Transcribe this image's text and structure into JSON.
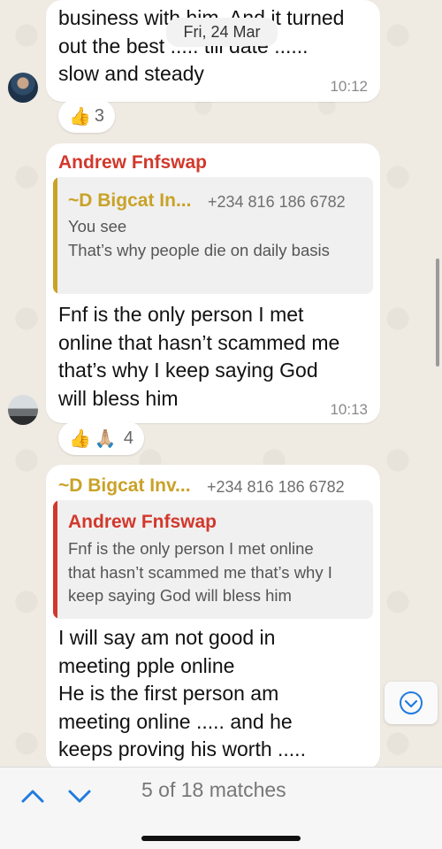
{
  "date_chip": "Fri, 24 Mar",
  "messages": [
    {
      "lines": [
        "business with him. And it turned",
        "out the best ..... till date ......",
        "slow and steady"
      ],
      "time": "10:12",
      "reaction": {
        "emojis": [
          "👍"
        ],
        "count": "3"
      }
    },
    {
      "sender": "Andrew Fnfswap",
      "quote": {
        "name": "~D Bigcat In...",
        "phone": "+234 816 186 6782",
        "lines": [
          "You see",
          "That’s why people die on daily basis"
        ]
      },
      "lines": [
        "Fnf is the only person I met",
        "online that hasn’t scammed me",
        "that’s why I keep saying God",
        "will bless him"
      ],
      "time": "10:13",
      "reaction": {
        "emojis": [
          "👍",
          "🙏🏼"
        ],
        "count": "4"
      }
    },
    {
      "sender": "~D Bigcat Inv...",
      "phone": "+234 816 186 6782",
      "quote": {
        "name": "Andrew Fnfswap",
        "lines": [
          "Fnf is the only person I met online",
          "that hasn’t scammed me that’s why I",
          "keep saying God will bless him"
        ]
      },
      "lines": [
        "I will say am not good in",
        "meeting pple online",
        "He is the first person am",
        "meeting online ..... and he",
        "keeps proving his worth ....."
      ]
    }
  ],
  "search": {
    "prev_icon": "chevron-up-icon",
    "next_icon": "chevron-down-icon",
    "matches": "5 of 18 matches"
  },
  "colors": {
    "accent_blue": "#1f7be0",
    "sender_red": "#d2382c",
    "quote_gold": "#c9a227",
    "quote_red": "#d2382c",
    "chat_background": "#efeae2"
  }
}
